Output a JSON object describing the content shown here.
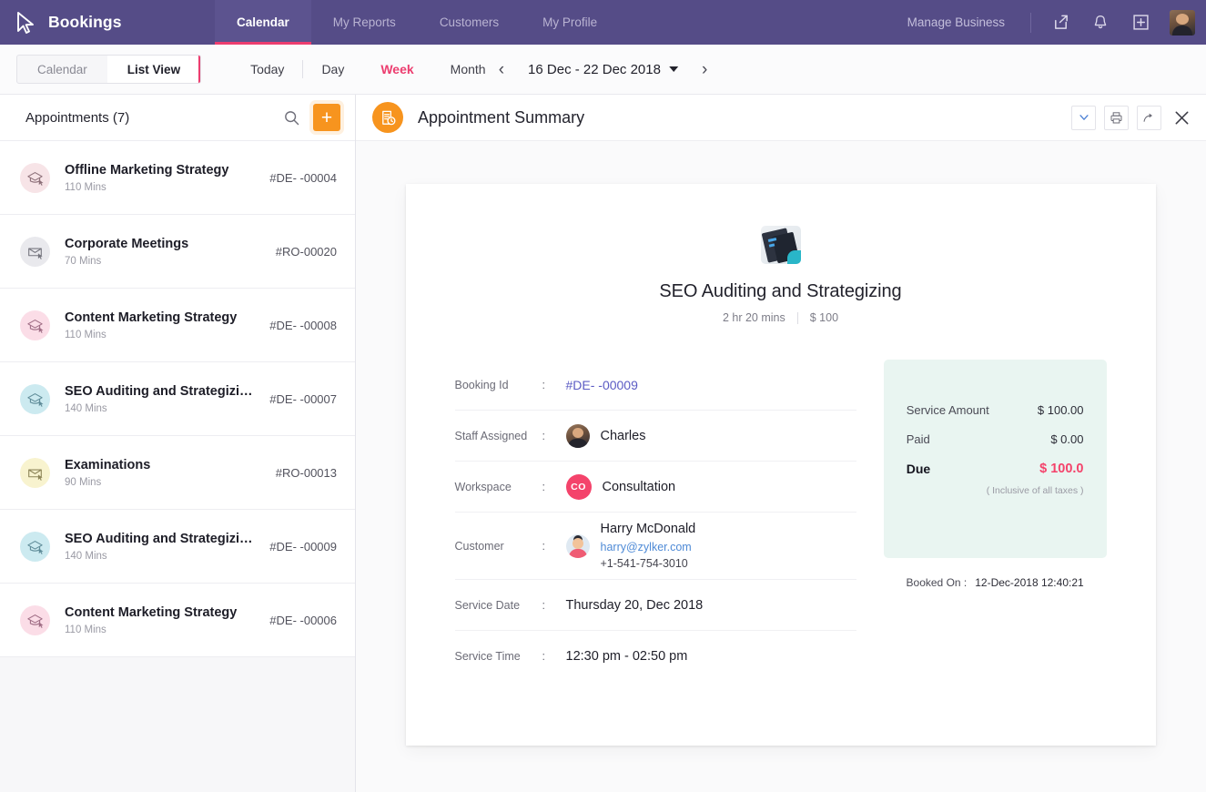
{
  "topbar": {
    "brand": "Bookings",
    "nav": [
      {
        "label": "Calendar",
        "active": true
      },
      {
        "label": "My Reports",
        "active": false
      },
      {
        "label": "Customers",
        "active": false
      },
      {
        "label": "My Profile",
        "active": false
      }
    ],
    "manage_business": "Manage Business",
    "icons": [
      "share-external-icon",
      "bell-icon",
      "plus-box-icon",
      "user-avatar"
    ]
  },
  "toolbar": {
    "segmented": [
      {
        "label": "Calendar",
        "active": false
      },
      {
        "label": "List View",
        "active": true
      }
    ],
    "views": [
      {
        "label": "Today",
        "accent": false
      },
      {
        "label": "Day",
        "accent": false
      },
      {
        "label": "Week",
        "accent": true
      },
      {
        "label": "Month",
        "accent": false
      }
    ],
    "date_range": "16 Dec - 22 Dec 2018",
    "prev_arrow": "‹",
    "next_arrow": "›"
  },
  "sidebar": {
    "title": "Appointments (7)",
    "add_label": "+",
    "appointments": [
      {
        "name": "Offline Marketing Strategy",
        "duration": "110 Mins",
        "id": "#DE- -00004",
        "color": "#f7e4e7"
      },
      {
        "name": "Corporate Meetings",
        "duration": "70 Mins",
        "id": "#RO-00020",
        "color": "#e9e9ed"
      },
      {
        "name": "Content Marketing Strategy",
        "duration": "110 Mins",
        "id": "#DE- -00008",
        "color": "#fbdde7"
      },
      {
        "name": "SEO Auditing and Strategizing",
        "duration": "140 Mins",
        "id": "#DE- -00007",
        "color": "#cceaf0"
      },
      {
        "name": "Examinations",
        "duration": "90 Mins",
        "id": "#RO-00013",
        "color": "#f8f3cf"
      },
      {
        "name": "SEO Auditing and Strategizing",
        "duration": "140 Mins",
        "id": "#DE- -00009",
        "color": "#cceaf0"
      },
      {
        "name": "Content Marketing Strategy",
        "duration": "110 Mins",
        "id": "#DE- -00006",
        "color": "#fbdde7"
      }
    ]
  },
  "summary": {
    "header_title": "Appointment Summary",
    "service_name": "SEO Auditing and Strategizing",
    "service_duration": "2 hr 20 mins",
    "service_price": "$ 100",
    "fields": [
      {
        "label": "Booking Id",
        "value": "#DE- -00009"
      },
      {
        "label": "Staff Assigned",
        "value": "Charles"
      },
      {
        "label": "Workspace",
        "value": "Consultation",
        "badge": "CO"
      },
      {
        "label": "Customer",
        "value": "Harry McDonald",
        "email": "harry@zylker.com",
        "phone": "+1-541-754-3010"
      },
      {
        "label": "Service Date",
        "value": "Thursday 20, Dec 2018"
      },
      {
        "label": "Service Time",
        "value": "12:30 pm - 02:50 pm"
      }
    ],
    "payment": {
      "service_amount_label": "Service Amount",
      "service_amount_value": "$ 100.00",
      "paid_label": "Paid",
      "paid_value": "$ 0.00",
      "due_label": "Due",
      "due_value": "$ 100.0",
      "tax_note": "( Inclusive of all taxes )"
    },
    "booked_on_label": "Booked On :",
    "booked_on_value": "12-Dec-2018 12:40:21"
  },
  "colors": {
    "purple": "#554c87",
    "accent_pink": "#ec3d6f",
    "orange": "#f7941e",
    "due_red": "#f4436b",
    "pay_bg": "#e9f5f1"
  }
}
